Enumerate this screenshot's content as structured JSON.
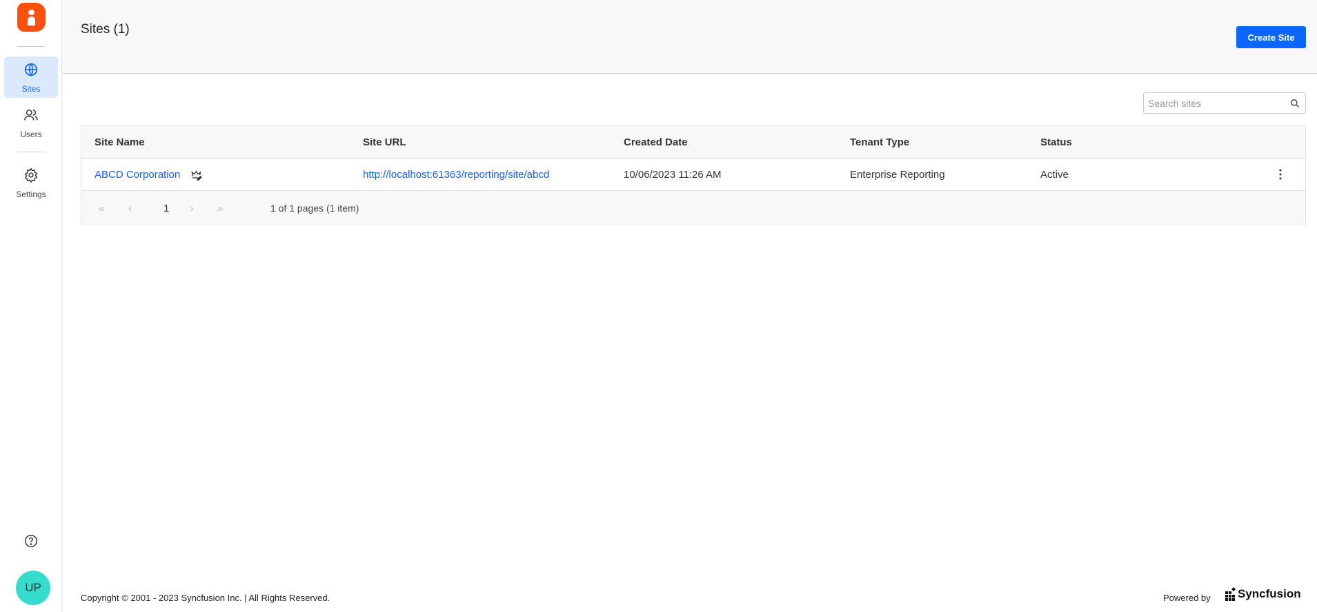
{
  "sidebar": {
    "items": [
      {
        "label": "Sites",
        "icon": "globe-icon"
      },
      {
        "label": "Users",
        "icon": "users-icon"
      },
      {
        "label": "Settings",
        "icon": "gear-icon"
      }
    ],
    "avatar": "UP"
  },
  "header": {
    "title": "Sites (1)",
    "create_label": "Create Site"
  },
  "search": {
    "placeholder": "Search sites"
  },
  "table": {
    "columns": [
      "Site Name",
      "Site URL",
      "Created Date",
      "Tenant Type",
      "Status"
    ],
    "rows": [
      {
        "name": "ABCD Corporation",
        "url": "http://localhost:61363/reporting/site/abcd",
        "created": "10/06/2023 11:26 AM",
        "tenant": "Enterprise Reporting",
        "status": "Active"
      }
    ]
  },
  "pager": {
    "current": "1",
    "info": "1 of 1 pages (1 item)"
  },
  "footer": {
    "copyright": "Copyright © 2001 - 2023 Syncfusion Inc. | All Rights Reserved.",
    "powered": "Powered by",
    "brand": "Syncfusion"
  },
  "colors": {
    "accent": "#0a66ff",
    "logo": "#ff4f0c",
    "avatar": "#35dccb"
  }
}
